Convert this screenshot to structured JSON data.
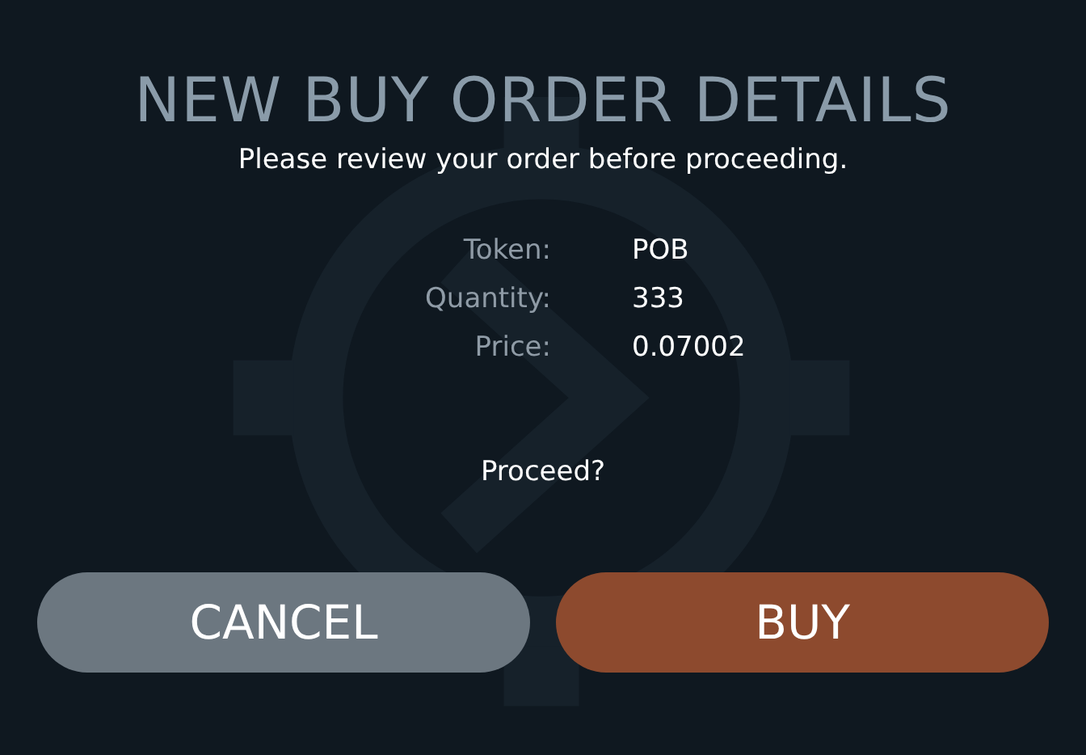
{
  "dialog": {
    "title": "NEW BUY ORDER DETAILS",
    "subtitle": "Please review your order before proceeding.",
    "details": [
      {
        "label": "Token:",
        "value": "POB"
      },
      {
        "label": "Quantity:",
        "value": "333"
      },
      {
        "label": "Price:",
        "value": "0.07002"
      }
    ],
    "prompt": "Proceed?",
    "buttons": [
      {
        "label": "CANCEL",
        "kind": "cancel"
      },
      {
        "label": "BUY",
        "kind": "confirm"
      }
    ]
  }
}
